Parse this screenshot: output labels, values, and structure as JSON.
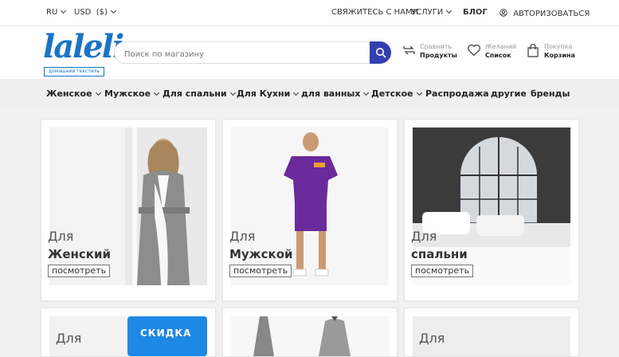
{
  "topbar": {
    "language": "RU",
    "currency": "USD  ($)",
    "contact": "Свяжитесь с нами",
    "services": "Услуги",
    "blog": "БЛОГ",
    "login": "Авторизоваться"
  },
  "logo": {
    "text": "laleli",
    "tagline": "домашний текстиль"
  },
  "search": {
    "placeholder": "Поиск по магазину"
  },
  "header_links": {
    "compare": {
      "line1": "Сравнить",
      "line2": "Продукты"
    },
    "wishlist": {
      "line1": "Желаний",
      "line2": "Список"
    },
    "cart": {
      "line1": "Покупка",
      "line2": "Корзина"
    }
  },
  "nav": [
    "Женское",
    "Мужское",
    "Для спальни",
    "Для Кухни",
    "для ванных",
    "Детское",
    "Распродажа",
    "другие",
    "бренды"
  ],
  "cards": [
    {
      "line1": "Для",
      "line2": "Женский",
      "button": "посмотреть"
    },
    {
      "line1": "Для",
      "line2": "Мужской",
      "button": "посмотреть"
    },
    {
      "line1": "Для",
      "line2": "спальни",
      "button": "посмотреть"
    }
  ],
  "bottom_cards": [
    {
      "line1": "Для",
      "badge": "Скидка"
    },
    {
      "line1": ""
    },
    {
      "line1": "Для"
    }
  ],
  "colors": {
    "accent": "#3340b0",
    "logo": "#1a73c8"
  }
}
